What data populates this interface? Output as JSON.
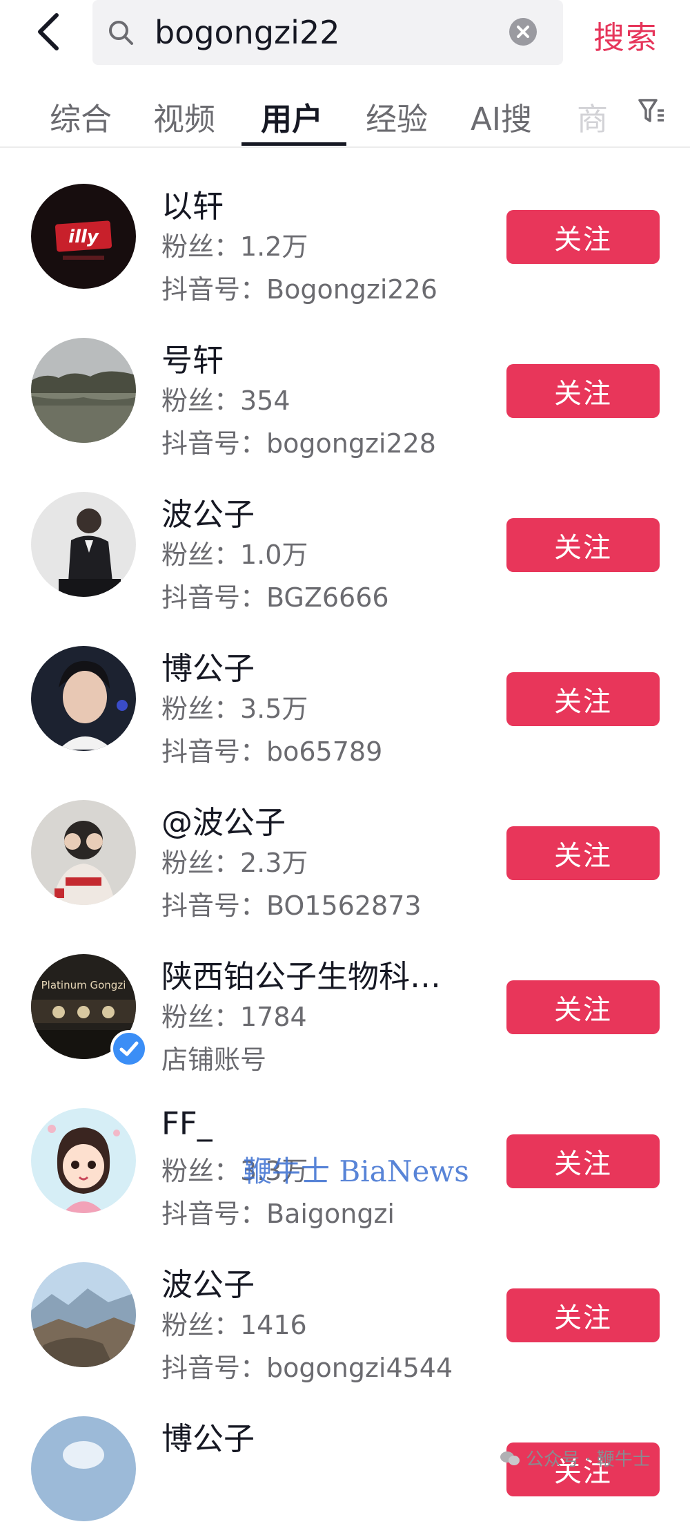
{
  "search": {
    "query": "bogongzi22",
    "button_label": "搜索"
  },
  "tabs": [
    {
      "label": "综合"
    },
    {
      "label": "视频"
    },
    {
      "label": "用户"
    },
    {
      "label": "经验"
    },
    {
      "label": "AI搜"
    },
    {
      "label": "商"
    }
  ],
  "active_tab": "用户",
  "users": [
    {
      "name": "以轩",
      "fans": "粉丝：1.2万",
      "account": "抖音号：Bogongzi226",
      "follow_label": "关注"
    },
    {
      "name": "号轩",
      "fans": "粉丝：354",
      "account": "抖音号：bogongzi228",
      "follow_label": "关注"
    },
    {
      "name": "波公子",
      "fans": "粉丝：1.0万",
      "account": "抖音号：BGZ6666",
      "follow_label": "关注"
    },
    {
      "name": "博公子",
      "fans": "粉丝：3.5万",
      "account": "抖音号：bo65789",
      "follow_label": "关注"
    },
    {
      "name": "@波公子",
      "fans": "粉丝：2.3万",
      "account": "抖音号：BO1562873",
      "follow_label": "关注"
    },
    {
      "name": "陕西铂公子生物科…",
      "fans": "粉丝：1784",
      "account": "店铺账号",
      "follow_label": "关注",
      "verified": true
    },
    {
      "name": "FF_",
      "fans": "粉丝：3.3万",
      "account": "抖音号：Baigongzi",
      "follow_label": "关注"
    },
    {
      "name": "波公子",
      "fans": "粉丝：1416",
      "account": "抖音号：bogongzi4544",
      "follow_label": "关注"
    },
    {
      "name": "博公子",
      "fans": "",
      "account": "",
      "follow_label": "关注"
    }
  ],
  "avatar_texts": {
    "illy": "illy",
    "platinum": "Platinum Gongzi"
  },
  "watermark": "鞭牛士 BiaNews",
  "credit": "公众号 · 鞭牛士",
  "colors": {
    "accent": "#e8365a",
    "search_text": "#e6355a",
    "verified": "#3b8ef6"
  }
}
